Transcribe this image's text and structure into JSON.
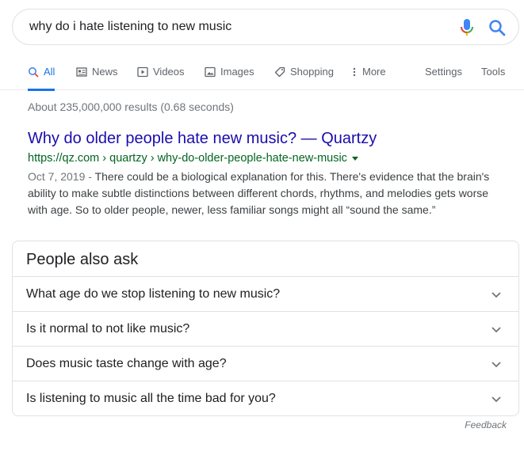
{
  "search": {
    "query": "why do i hate listening to new music"
  },
  "tabs": [
    {
      "label": "All",
      "active": true,
      "icon": "search-icon"
    },
    {
      "label": "News",
      "icon": "news-icon"
    },
    {
      "label": "Videos",
      "icon": "video-icon"
    },
    {
      "label": "Images",
      "icon": "image-icon"
    },
    {
      "label": "Shopping",
      "icon": "tag-icon"
    },
    {
      "label": "More",
      "icon": "more-vert-icon"
    },
    {
      "label": "Settings"
    },
    {
      "label": "Tools"
    }
  ],
  "stats": "About 235,000,000 results (0.68 seconds)",
  "result": {
    "title": "Why do older people hate new music? — Quartzy",
    "url": "https://qz.com › quartzy › why-do-older-people-hate-new-music",
    "date": "Oct 7, 2019 - ",
    "snippet": "There could be a biological explanation for this. There's evidence that the brain's ability to make subtle distinctions between different chords, rhythms, and melodies gets worse with age. So to older people, newer, less familiar songs might all “sound the same.”"
  },
  "people_also_ask": {
    "title": "People also ask",
    "questions": [
      "What age do we stop listening to new music?",
      "Is it normal to not like music?",
      "Does music taste change with age?",
      "Is listening to music all the time bad for you?"
    ]
  },
  "feedback_label": "Feedback",
  "colors": {
    "link": "#1a0dab",
    "url_green": "#006621",
    "accent_blue": "#1a73e8",
    "mic_red": "#ea4335"
  }
}
